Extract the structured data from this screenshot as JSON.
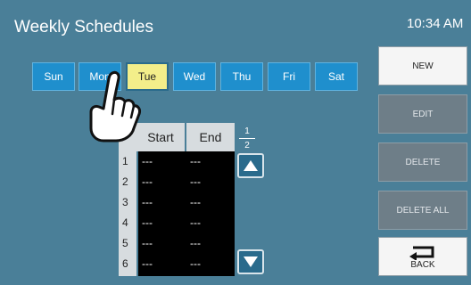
{
  "header": {
    "title": "Weekly Schedules",
    "time": "10:34 AM"
  },
  "days": [
    "Sun",
    "Mon",
    "Tue",
    "Wed",
    "Thu",
    "Fri",
    "Sat"
  ],
  "selected_day": "Tue",
  "table": {
    "headers": {
      "start": "Start",
      "end": "End"
    },
    "rows": [
      {
        "n": "1",
        "start": "---",
        "end": "---"
      },
      {
        "n": "2",
        "start": "---",
        "end": "---"
      },
      {
        "n": "3",
        "start": "---",
        "end": "---"
      },
      {
        "n": "4",
        "start": "---",
        "end": "---"
      },
      {
        "n": "5",
        "start": "---",
        "end": "---"
      },
      {
        "n": "6",
        "start": "---",
        "end": "---"
      }
    ]
  },
  "pager": {
    "current": "1",
    "total": "2"
  },
  "buttons": {
    "new": "NEW",
    "edit": "EDIT",
    "delete": "DELETE",
    "delete_all": "DELETE ALL",
    "back": "BACK"
  },
  "icons": {
    "scroll_up": "triangle-up-icon",
    "scroll_down": "triangle-down-icon",
    "back": "return-arrow-icon",
    "cursor": "pointing-hand-icon"
  },
  "colors": {
    "background": "#4a7f98",
    "day_button": "#1f8fcd",
    "day_selected": "#f3ee8a",
    "button_active": "#f5f5f5",
    "button_disabled": "#6e7e88"
  }
}
